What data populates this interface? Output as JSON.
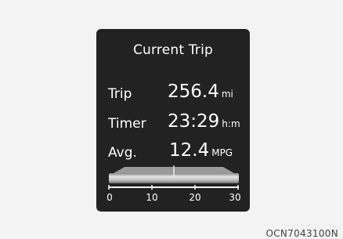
{
  "panel": {
    "title": "Current Trip",
    "rows": [
      {
        "label": "Trip",
        "value": "256.4",
        "unit": "mi"
      },
      {
        "label": "Timer",
        "value": "23:29",
        "unit": "h:m"
      },
      {
        "label": "Avg.",
        "value": "12.4",
        "unit": "MPG"
      }
    ],
    "gauge": {
      "ticks": [
        "0",
        "10",
        "20",
        "30"
      ],
      "bar_color": "#cfcfcf",
      "track_color": "#ffffff"
    }
  },
  "caption": "OCN7043100N"
}
